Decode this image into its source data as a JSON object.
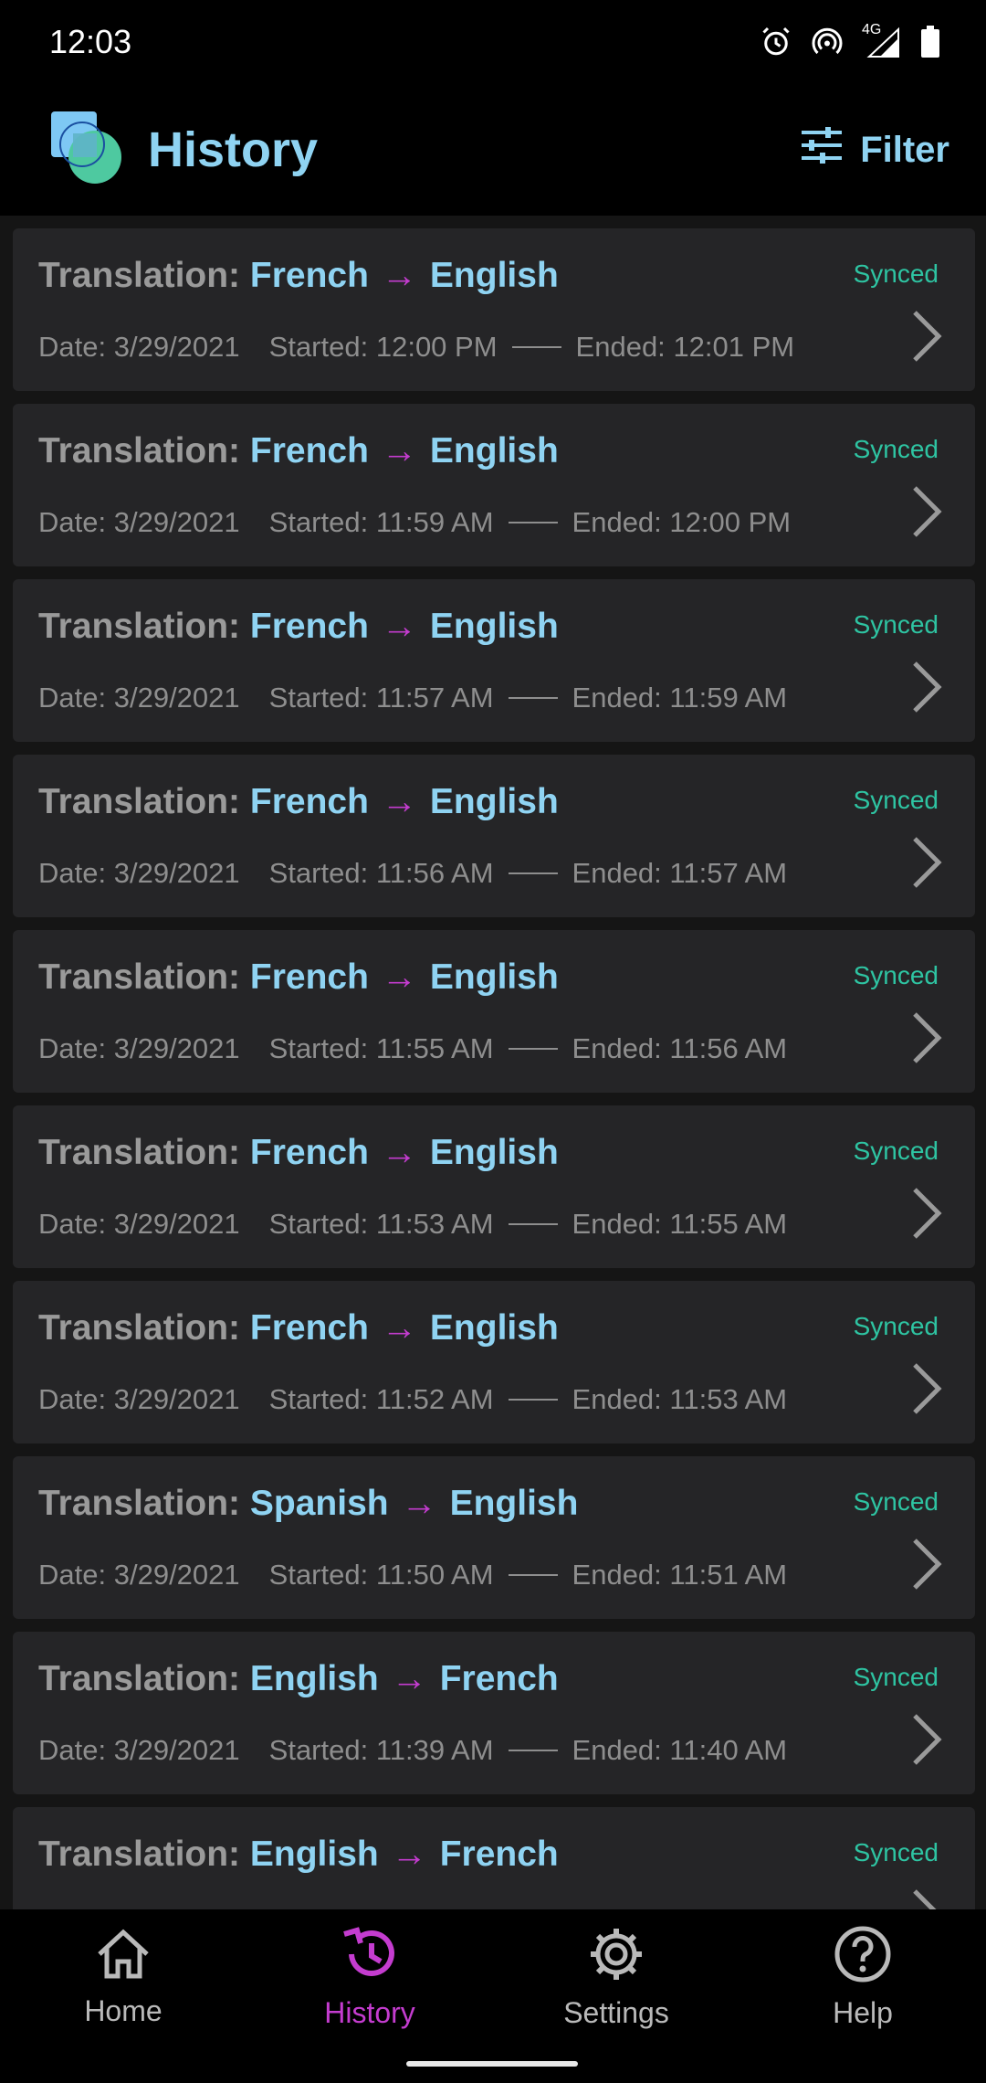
{
  "status_bar": {
    "time": "12:03",
    "network_label": "4G",
    "icons": [
      "alarm-icon",
      "hotspot-icon",
      "signal-icon",
      "battery-icon"
    ]
  },
  "header": {
    "title": "History",
    "filter_label": "Filter",
    "icons": [
      "app-logo",
      "filter-sliders-icon"
    ]
  },
  "labels": {
    "translation_prefix": "Translation:",
    "arrow": "→",
    "date_prefix": "Date:",
    "started_prefix": "Started:",
    "ended_prefix": "Ended:"
  },
  "history": [
    {
      "from": "French",
      "to": "English",
      "date": "3/29/2021",
      "started": "12:00 PM",
      "ended": "12:01 PM",
      "status": "Synced"
    },
    {
      "from": "French",
      "to": "English",
      "date": "3/29/2021",
      "started": "11:59 AM",
      "ended": "12:00 PM",
      "status": "Synced"
    },
    {
      "from": "French",
      "to": "English",
      "date": "3/29/2021",
      "started": "11:57 AM",
      "ended": "11:59 AM",
      "status": "Synced"
    },
    {
      "from": "French",
      "to": "English",
      "date": "3/29/2021",
      "started": "11:56 AM",
      "ended": "11:57 AM",
      "status": "Synced"
    },
    {
      "from": "French",
      "to": "English",
      "date": "3/29/2021",
      "started": "11:55 AM",
      "ended": "11:56 AM",
      "status": "Synced"
    },
    {
      "from": "French",
      "to": "English",
      "date": "3/29/2021",
      "started": "11:53 AM",
      "ended": "11:55 AM",
      "status": "Synced"
    },
    {
      "from": "French",
      "to": "English",
      "date": "3/29/2021",
      "started": "11:52 AM",
      "ended": "11:53 AM",
      "status": "Synced"
    },
    {
      "from": "Spanish",
      "to": "English",
      "date": "3/29/2021",
      "started": "11:50 AM",
      "ended": "11:51 AM",
      "status": "Synced"
    },
    {
      "from": "English",
      "to": "French",
      "date": "3/29/2021",
      "started": "11:39 AM",
      "ended": "11:40 AM",
      "status": "Synced"
    },
    {
      "from": "English",
      "to": "French",
      "date": "",
      "started": "",
      "ended": "",
      "status": "Synced"
    }
  ],
  "nav": {
    "items": [
      {
        "label": "Home",
        "icon": "home-icon",
        "active": false
      },
      {
        "label": "History",
        "icon": "history-icon",
        "active": true
      },
      {
        "label": "Settings",
        "icon": "gear-icon",
        "active": false
      },
      {
        "label": "Help",
        "icon": "help-icon",
        "active": false
      }
    ]
  },
  "colors": {
    "accent_blue": "#8fd3f2",
    "accent_purple": "#c43ccf",
    "synced_green": "#2ec4a2",
    "card_bg": "#252527"
  }
}
